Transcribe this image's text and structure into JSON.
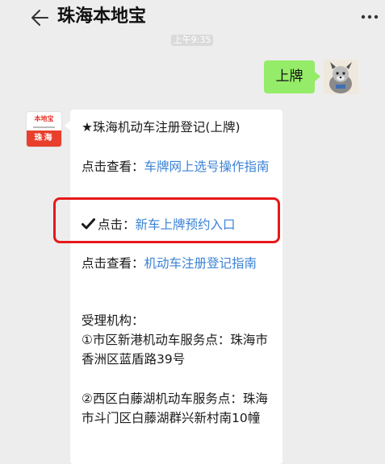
{
  "header": {
    "title": "珠海本地宝",
    "back_icon": "arrow-left-icon",
    "more_icon": "more-dots-icon"
  },
  "time_label": "上午9:35",
  "outgoing": {
    "text": "上牌"
  },
  "bot_avatar": {
    "logo_text": "本地宝",
    "city": "珠海"
  },
  "message": {
    "title": "★珠海机动车注册登记(上牌)",
    "line1_prefix": "点击查看：",
    "line1_link": "车牌网上选号操作指南",
    "line2_prefix": "点击：",
    "line2_link": "新车上牌预约入口",
    "line3_prefix": "点击查看：",
    "line3_link": "机动车注册登记指南",
    "section_label": "受理机构：",
    "office1": "①市区新港机动车服务点：珠海市香洲区蓝盾路39号",
    "office2": "②西区白藤湖机动车服务点：珠海市斗门区白藤湖群兴新村南10幢"
  },
  "colors": {
    "accent_green": "#95ec69",
    "link_blue": "#3b83d6",
    "highlight_red": "#e5191b"
  }
}
